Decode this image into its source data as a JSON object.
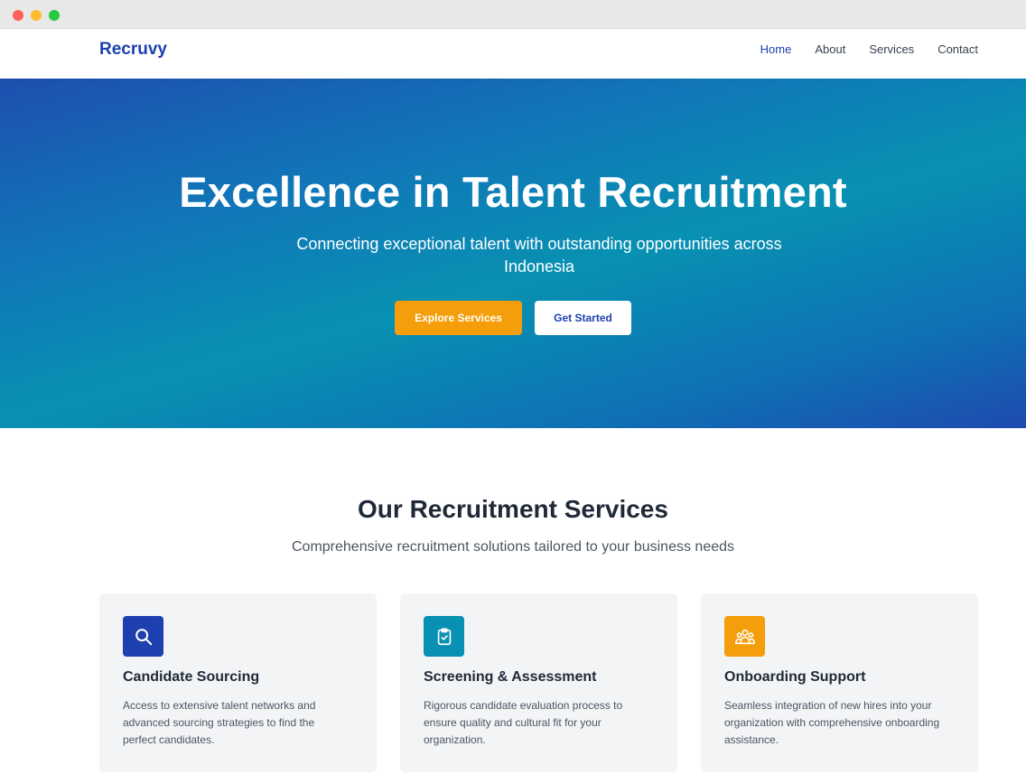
{
  "nav": {
    "brand": "Recruvy",
    "links": [
      {
        "label": "Home",
        "active": true
      },
      {
        "label": "About",
        "active": false
      },
      {
        "label": "Services",
        "active": false
      },
      {
        "label": "Contact",
        "active": false
      }
    ]
  },
  "hero": {
    "title": "Excellence in Talent Recruitment",
    "subtitle": "Connecting exceptional talent with outstanding opportunities across Indonesia",
    "primary_button": "Explore Services",
    "secondary_button": "Get Started"
  },
  "services": {
    "title": "Our Recruitment Services",
    "subtitle": "Comprehensive recruitment solutions tailored to your business needs",
    "cards": [
      {
        "icon": "search-icon",
        "icon_color": "#1e40af",
        "title": "Candidate Sourcing",
        "text": "Access to extensive talent networks and advanced sourcing strategies to find the perfect candidates."
      },
      {
        "icon": "clipboard-check-icon",
        "icon_color": "#0891b2",
        "title": "Screening & Assessment",
        "text": "Rigorous candidate evaluation process to ensure quality and cultural fit for your organization."
      },
      {
        "icon": "users-group-icon",
        "icon_color": "#f59e0b",
        "title": "Onboarding Support",
        "text": "Seamless integration of new hires into your organization with comprehensive onboarding assistance."
      }
    ]
  },
  "colors": {
    "brand": "#1e40af",
    "accent": "#f59e0b",
    "teal": "#0891b2"
  }
}
